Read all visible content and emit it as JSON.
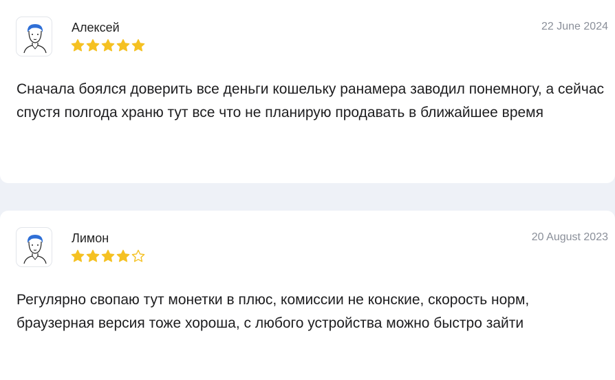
{
  "reviews": [
    {
      "author": "Алексей",
      "date": "22 June 2024",
      "rating": 5,
      "rating_max": 5,
      "text": "Сначала боялся доверить все деньги кошельку ранамера заводил понемногу, а сейчас спустя полгода храню тут все что не планирую продавать в ближайшее время"
    },
    {
      "author": "Лимон",
      "date": "20 August 2023",
      "rating": 4,
      "rating_max": 5,
      "text": "Регулярно свопаю тут монетки в плюс, комиссии не конские, скорость норм, браузерная версия тоже хороша, с любого устройства можно быстро зайти"
    }
  ],
  "colors": {
    "star": "#f5c122",
    "background": "#eef1f7",
    "hair": "#2f6fd6"
  },
  "icons": {
    "avatar": "user-avatar-icon",
    "star_full": "star-filled-icon",
    "star_empty": "star-outline-icon"
  }
}
